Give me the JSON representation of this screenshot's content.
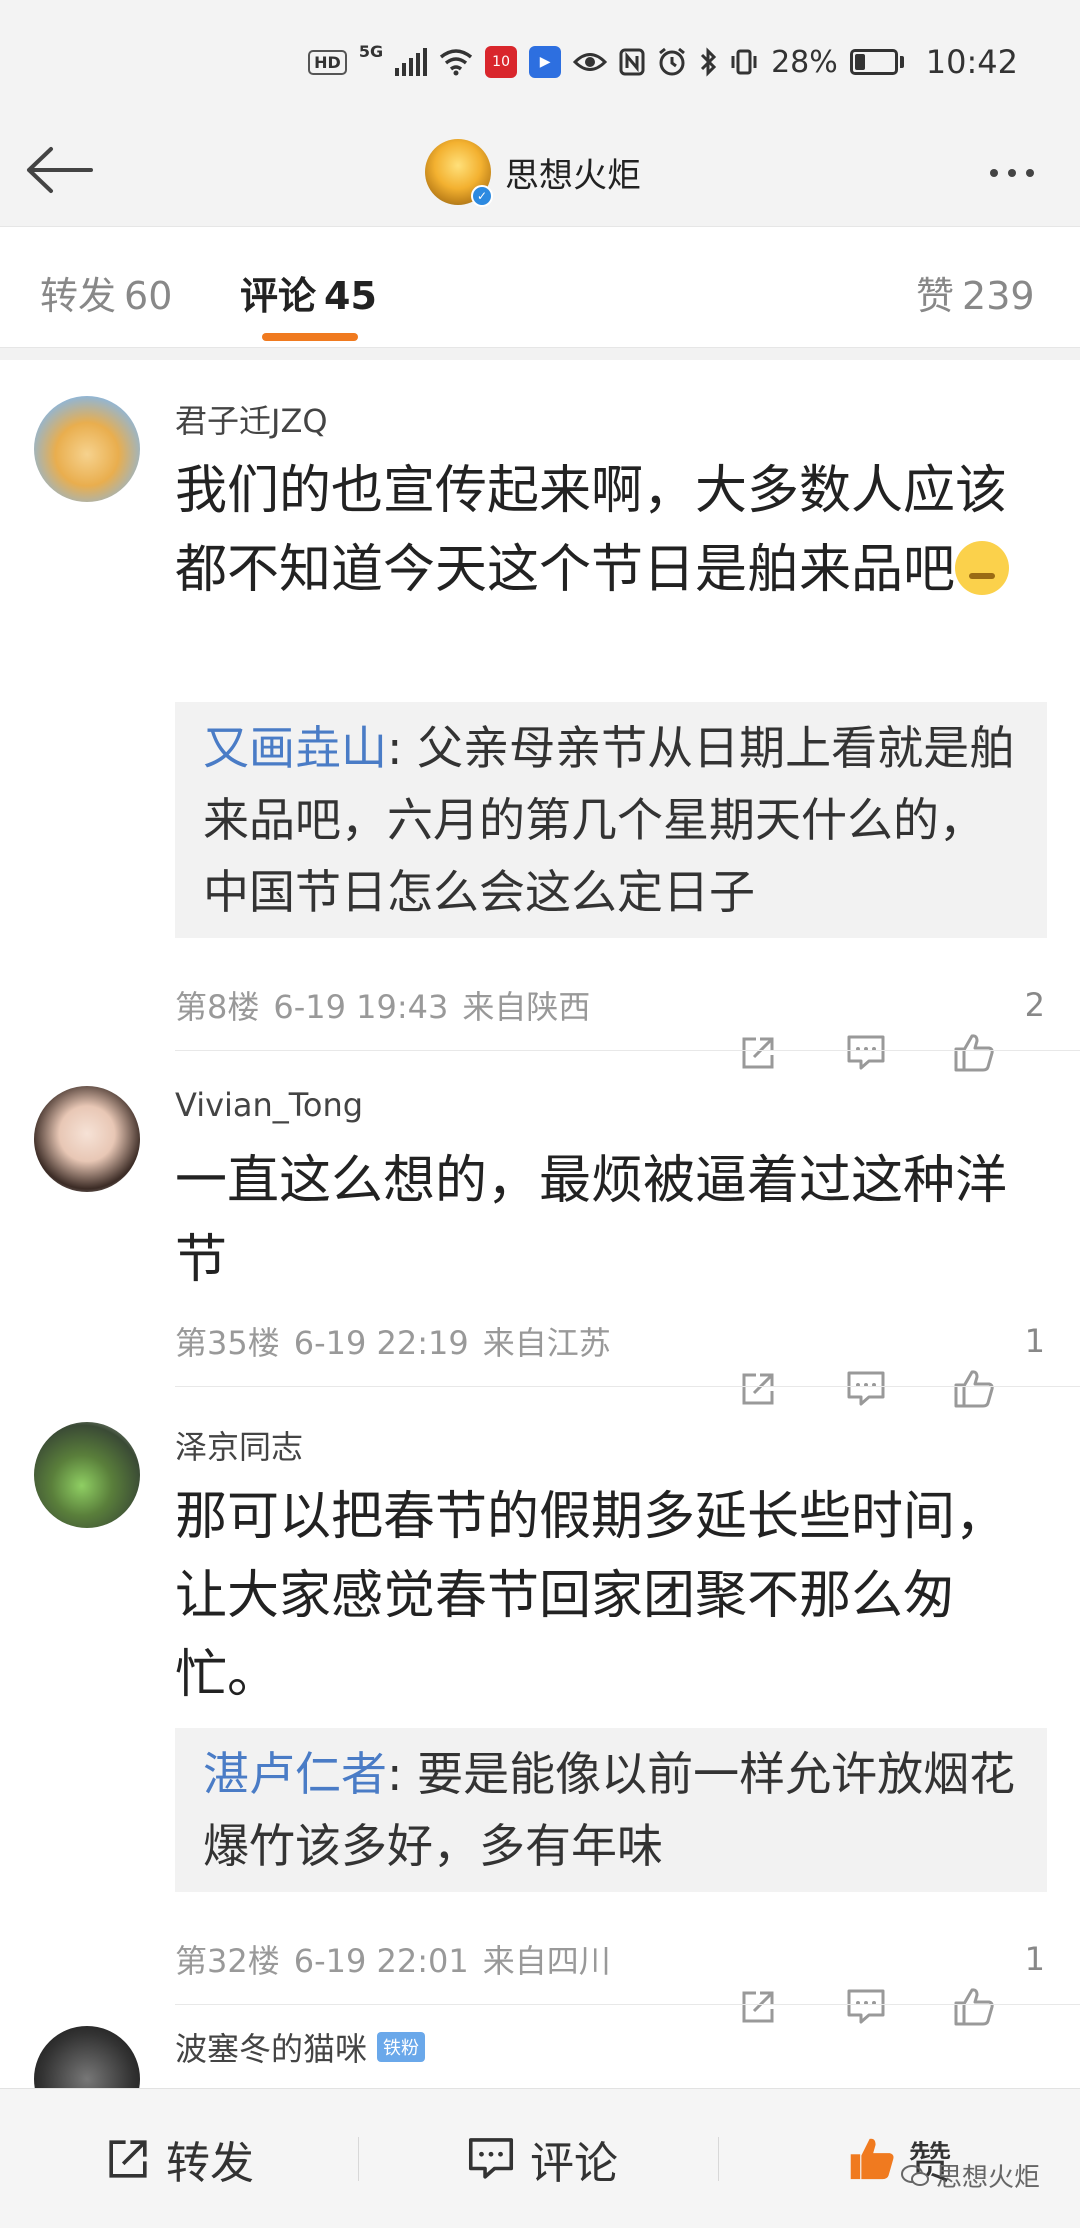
{
  "status_bar": {
    "hd": "HD",
    "network": "5G",
    "network2": "6",
    "app_red_label": "10",
    "battery_percent": "28%",
    "battery_level": 0.28,
    "time": "10:42"
  },
  "nav": {
    "title": "思想火炬"
  },
  "tabs": [
    {
      "label": "转发",
      "count": "60"
    },
    {
      "label": "评论",
      "count": "45"
    },
    {
      "label": "赞",
      "count": "239"
    }
  ],
  "comments": [
    {
      "username": "君子迁JZQ",
      "text": "我们的也宣传起来啊，大多数人应该都不知道今天这个节日是舶来品吧",
      "quote_name": "又画垚山",
      "quote_text": ": 父亲母亲节从日期上看就是舶来品吧，六月的第几个星期天什么的，中国节日怎么会这么定日子",
      "floor": "第8楼",
      "time": "6-19 19:43",
      "location": "来自陕西",
      "likes": "2"
    },
    {
      "username": "Vivian_Tong",
      "text": "一直这么想的，最烦被逼着过这种洋节",
      "floor": "第35楼",
      "time": "6-19 22:19",
      "location": "来自江苏",
      "likes": "1"
    },
    {
      "username": "泽京同志",
      "text": "那可以把春节的假期多延长些时间，让大家感觉春节回家团聚不那么匆忙。",
      "quote_name": "湛卢仁者",
      "quote_text": ": 要是能像以前一样允许放烟花爆竹该多好，多有年味",
      "floor": "第32楼",
      "time": "6-19 22:01",
      "location": "来自四川",
      "likes": "1"
    },
    {
      "username": "波塞冬的猫咪",
      "badge": "铁粉"
    }
  ],
  "bottom_bar": {
    "repost": "转发",
    "comment": "评论",
    "like": "赞",
    "watermark": "思想火炬"
  },
  "colors": {
    "accent": "#f07a1f",
    "link": "#4a7cc6",
    "like_active": "#f07a1f"
  }
}
